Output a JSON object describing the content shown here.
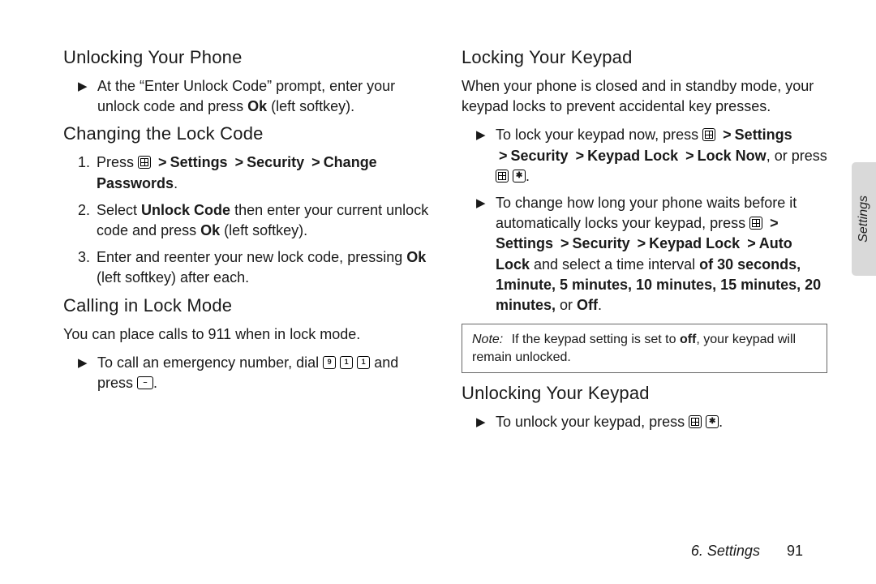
{
  "left": {
    "h1": "Unlocking Your Phone",
    "s1_b1_a": "At the “Enter Unlock Code” prompt, enter your unlock code and press ",
    "s1_b1_b": "Ok",
    "s1_b1_c": " (left softkey).",
    "h2": "Changing the Lock Code",
    "s2_n1_a": "Press ",
    "gt": ">",
    "s2_n1_b": "Settings",
    "s2_n1_c": "Security",
    "s2_n1_d": "Change Passwords",
    "s2_n1_e": ".",
    "s2_n2_a": "Select ",
    "s2_n2_b": "Unlock Code",
    "s2_n2_c": " then enter your current unlock code and press ",
    "s2_n2_d": "Ok",
    "s2_n2_e": " (left softkey).",
    "s2_n3_a": "Enter and reenter your new lock code, pressing ",
    "s2_n3_b": "Ok",
    "s2_n3_c": " (left softkey) after each.",
    "h3": "Calling in Lock Mode",
    "s3_p": "You can place calls to 911 when in lock mode.",
    "s3_b1_a": "To call an emergency number, dial ",
    "s3_b1_b": " and press ",
    "s3_b1_c": "."
  },
  "right": {
    "h1": "Locking Your Keypad",
    "s1_p": "When your phone is closed and in standby mode, your keypad locks to prevent accidental key presses.",
    "s1_b1_a": "To lock your keypad now, press ",
    "s1_b1_b": "Settings",
    "s1_b1_c": "Security",
    "s1_b1_d": "Keypad Lock",
    "s1_b1_e": "Lock Now",
    "s1_b1_f": ", or press ",
    "s1_b1_g": ".",
    "s1_b2_a": "To change how long your phone waits before it automatically locks your keypad, press ",
    "s1_b2_b": "Settings",
    "s1_b2_c": "Security",
    "s1_b2_d": "Keypad Lock",
    "s1_b2_e": "Auto Lock",
    "s1_b2_f": " and select a time interval ",
    "s1_b2_g": "of 30 seconds, 1minute, 5 minutes, 10 minutes, 15 minutes, 20 minutes,",
    "s1_b2_h": " or ",
    "s1_b2_i": "Off",
    "s1_b2_j": ".",
    "note_label": "Note:",
    "note_a": "If the keypad setting is set to ",
    "note_b": "off",
    "note_c": ", your keypad will remain unlocked.",
    "h2": "Unlocking Your Keypad",
    "s2_b1_a": "To unlock your keypad, press ",
    "s2_b1_b": "."
  },
  "aside": {
    "tab": "Settings"
  },
  "footer": {
    "section": "6. Settings",
    "page": "91"
  },
  "markers": {
    "bullet": "▶",
    "n1": "1.",
    "n2": "2.",
    "n3": "3."
  }
}
